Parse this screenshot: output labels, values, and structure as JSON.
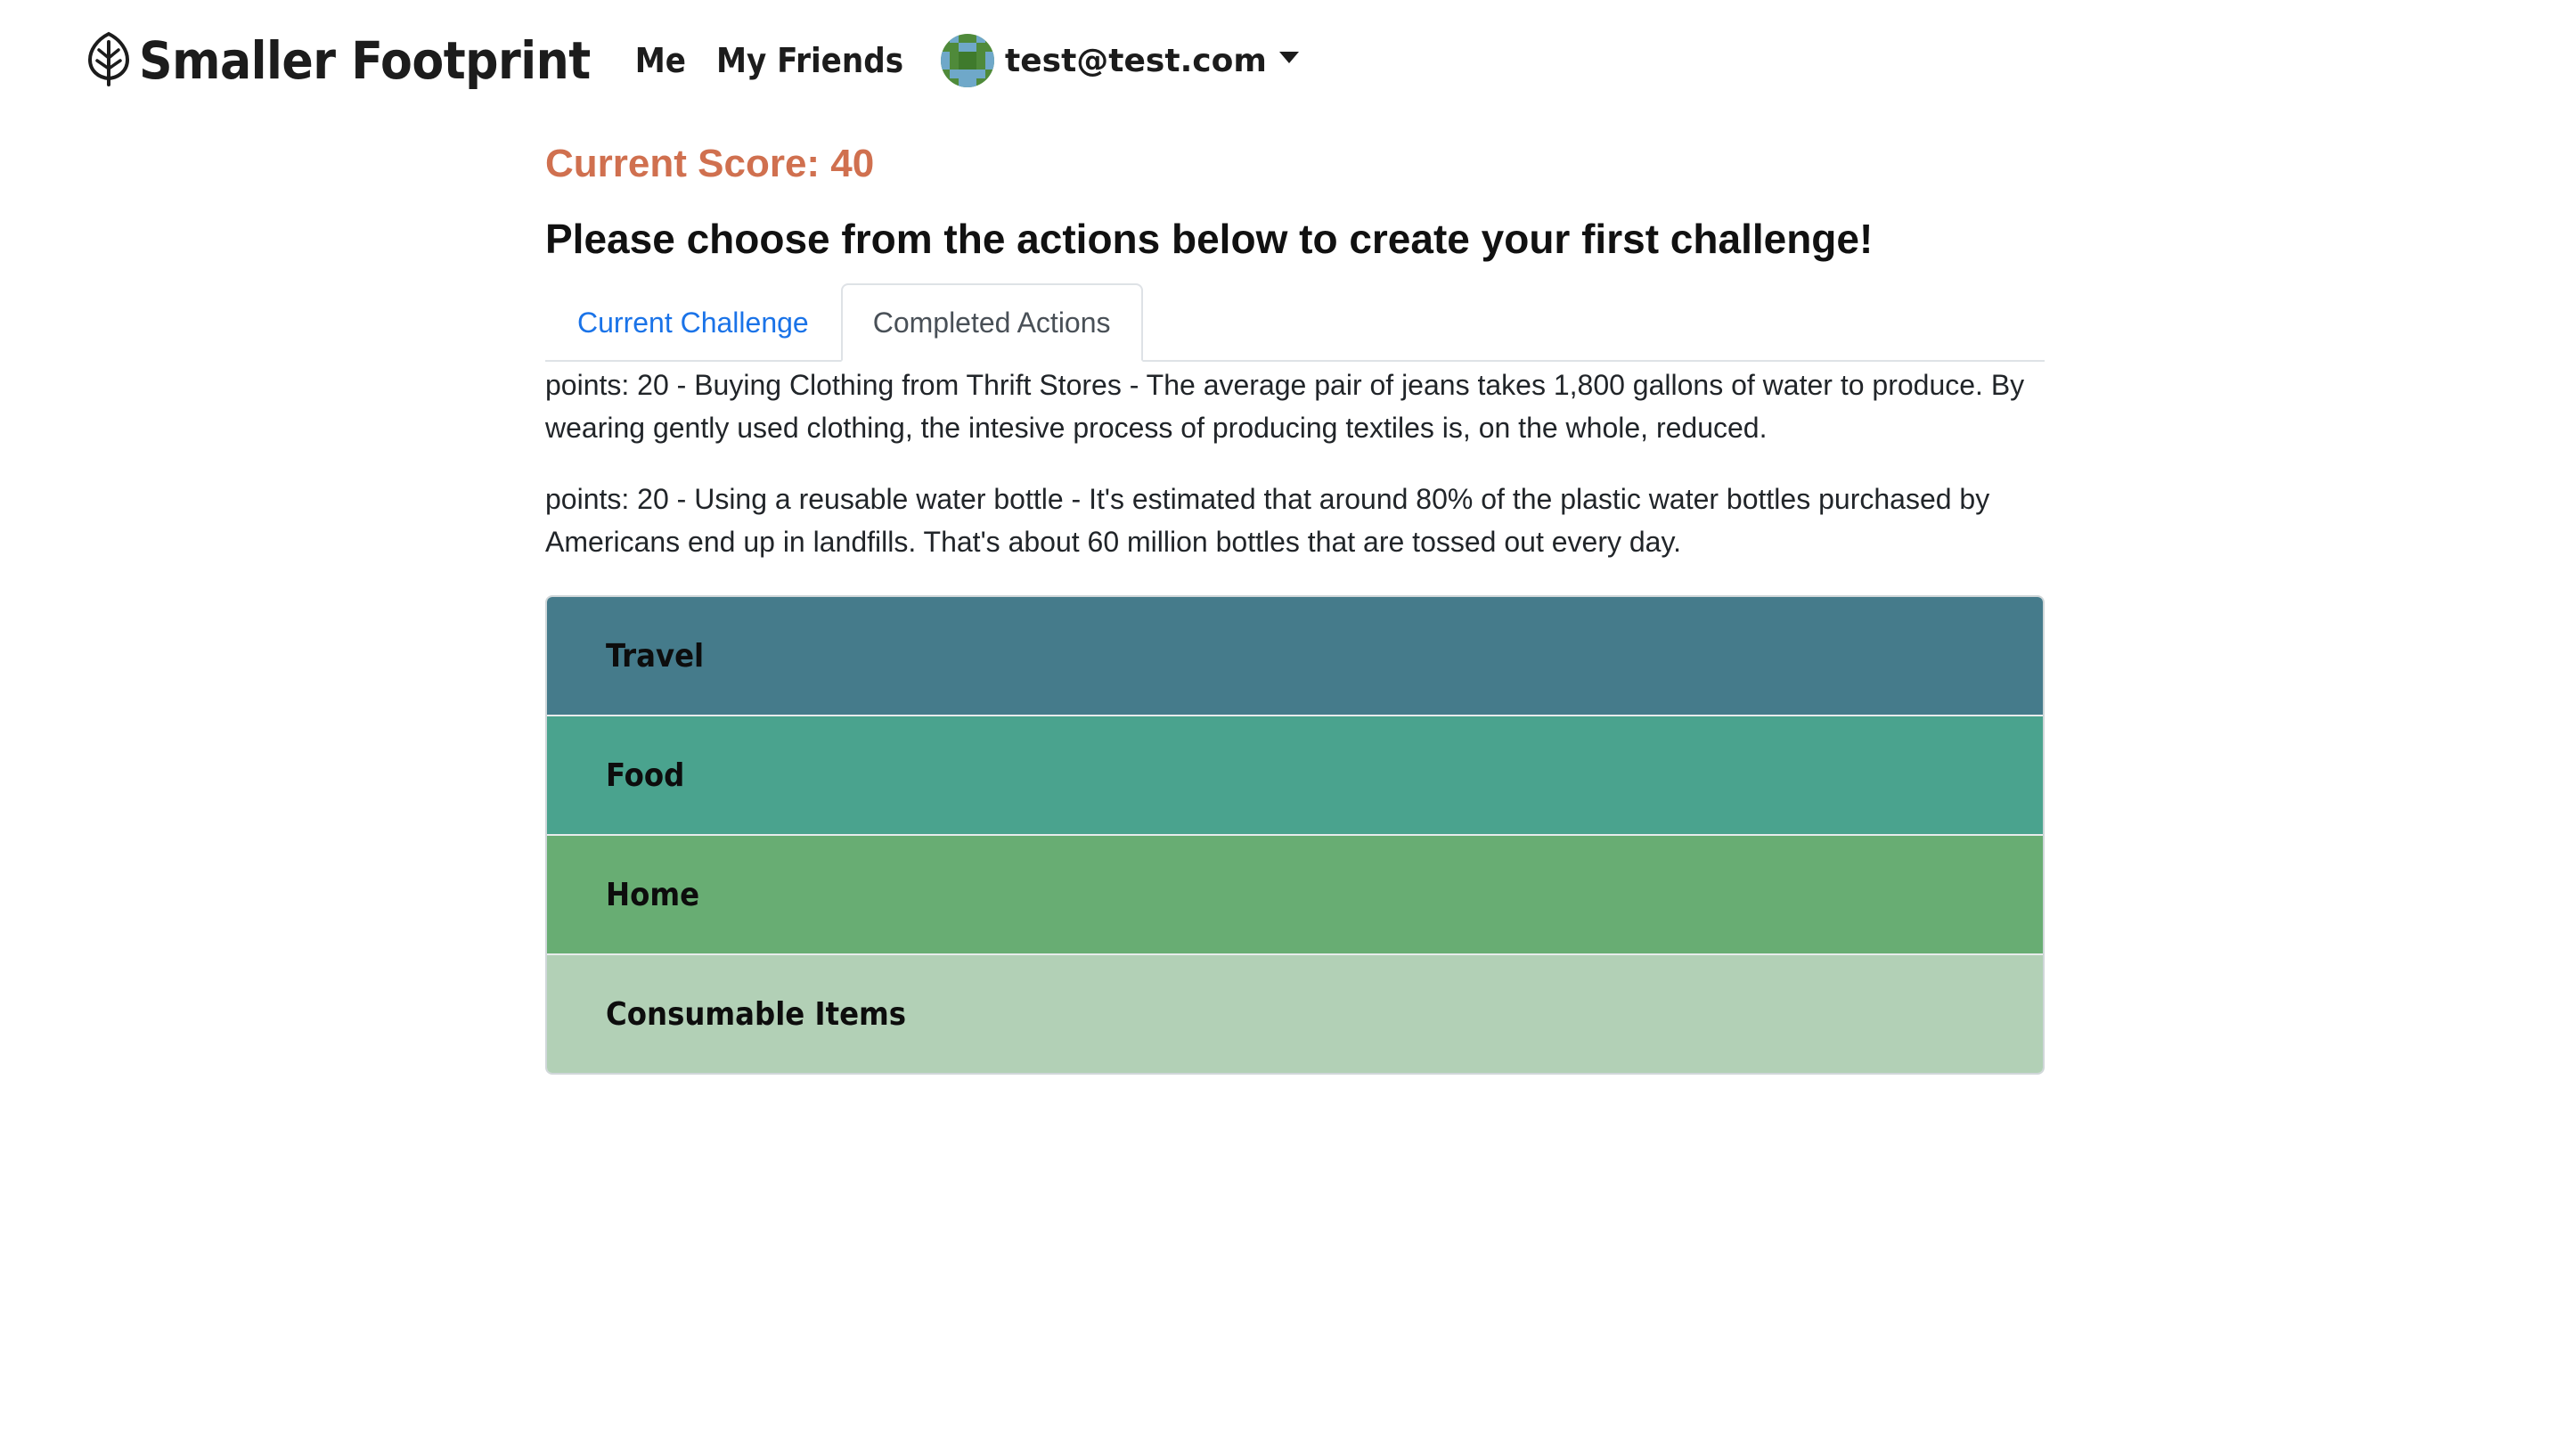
{
  "nav": {
    "brand": "Smaller Footprint",
    "links": [
      "Me",
      "My Friends"
    ],
    "user_email": "test@test.com"
  },
  "main": {
    "score": "Current Score: 40",
    "prompt": "Please choose from the actions below to create your first challenge!",
    "tabs": [
      {
        "label": "Current Challenge",
        "active": false
      },
      {
        "label": "Completed Actions",
        "active": true
      }
    ],
    "completed_actions": [
      "points: 20 - Buying Clothing from Thrift Stores - The average pair of jeans takes 1,800 gallons of water to produce. By wearing gently used clothing, the intesive process of producing textiles is, on the whole, reduced.",
      "points: 20 - Using a reusable water bottle - It's estimated that around 80% of the plastic water bottles purchased by Americans end up in landfills. That's about 60 million bottles that are tossed out every day."
    ],
    "categories": [
      {
        "label": "Travel",
        "color": "#457b8b"
      },
      {
        "label": "Food",
        "color": "#4aa38e"
      },
      {
        "label": "Home",
        "color": "#68ad73"
      },
      {
        "label": "Consumable Items",
        "color": "#b2d0b6"
      }
    ]
  },
  "colors": {
    "score": "#d0704f",
    "tab_link": "#1a73e8"
  },
  "icons": {
    "brand": "leaf-icon",
    "avatar": "pixel-avatar-icon",
    "dropdown": "caret-down-icon"
  }
}
